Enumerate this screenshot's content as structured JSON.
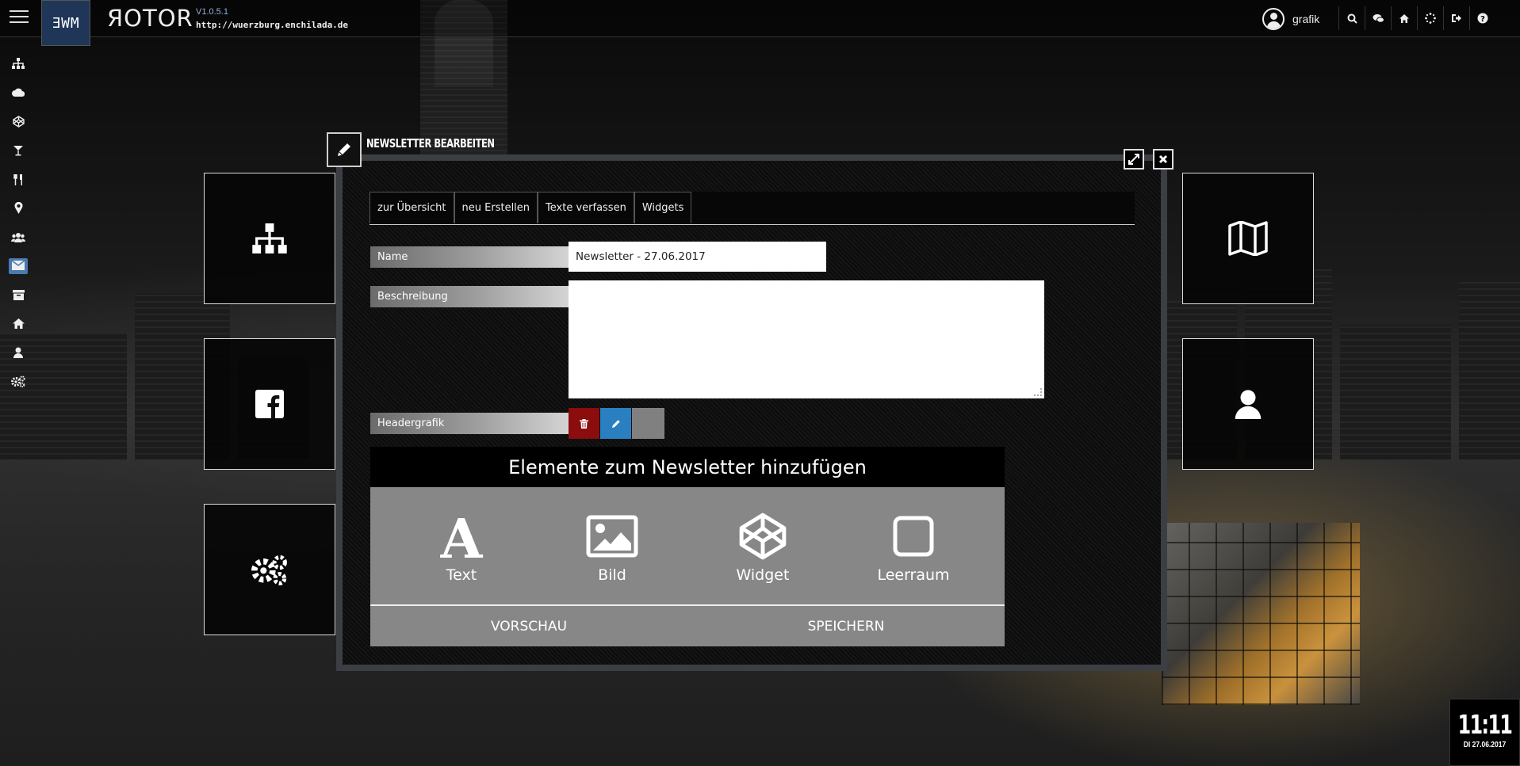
{
  "topbar": {
    "logo_text": "ƎWM",
    "brand": "ЯOTOR",
    "version": "V1.0.5.1",
    "url": "http://wuerzburg.enchilada.de",
    "username": "grafik",
    "icons": [
      "search-icon",
      "chat-icon",
      "home-icon",
      "loading-icon",
      "logout-icon",
      "help-icon"
    ]
  },
  "sidebar": {
    "items": [
      "sitemap-icon",
      "cloud-icon",
      "codepen-icon",
      "cocktail-icon",
      "cutlery-icon",
      "map-marker-icon",
      "users-icon",
      "envelope-icon",
      "archive-icon",
      "home-icon",
      "user-icon",
      "cogs-icon"
    ],
    "active": "envelope-icon"
  },
  "tiles_left": [
    "sitemap-icon",
    "facebook-icon",
    "cogs-icon"
  ],
  "tiles_right": [
    "map-icon",
    "user-icon"
  ],
  "dialog": {
    "title": "NEWSLETTER BEARBEITEN",
    "tabs": [
      "zur Übersicht",
      "neu Erstellen",
      "Texte verfassen",
      "Widgets"
    ],
    "fields": {
      "name_label": "Name",
      "name_value": "Newsletter - 27.06.2017",
      "description_label": "Beschreibung",
      "description_value": "",
      "header_label": "Headergrafik"
    },
    "add_panel": {
      "title": "Elemente zum Newsletter hinzufügen",
      "items": [
        {
          "label": "Text",
          "icon": "text-icon"
        },
        {
          "label": "Bild",
          "icon": "image-icon"
        },
        {
          "label": "Widget",
          "icon": "codepen-icon"
        },
        {
          "label": "Leerraum",
          "icon": "square-icon"
        }
      ],
      "preview": "VORSCHAU",
      "save": "SPEICHERN"
    }
  },
  "clock": {
    "time": "11:11",
    "date": "DI 27.06.2017"
  },
  "colors": {
    "accent_blue": "#2a7fc1",
    "delete_red": "#8b0d0d",
    "panel_grey": "#878787"
  }
}
